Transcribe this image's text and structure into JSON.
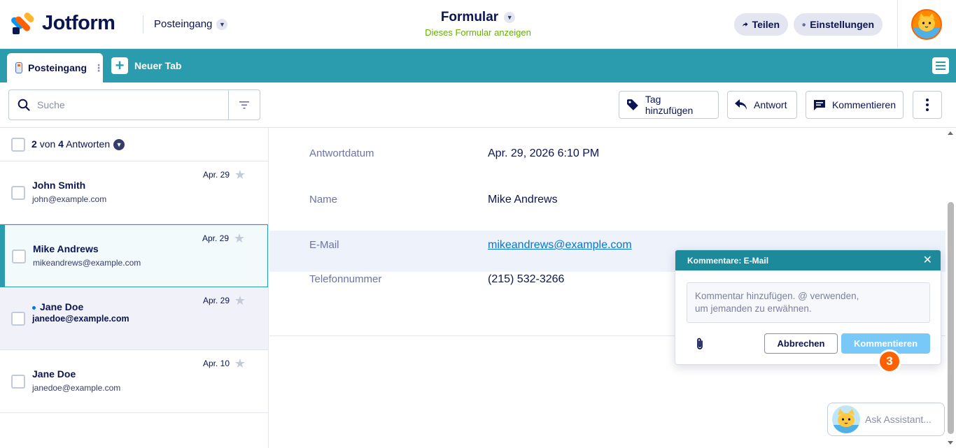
{
  "header": {
    "logo_text": "Jotform",
    "inbox_label": "Posteingang",
    "form_title": "Formular",
    "form_subtitle": "Dieses Formular anzeigen",
    "share_label": "Teilen",
    "settings_label": "Einstellungen"
  },
  "tabs": {
    "active_label": "Posteingang",
    "new_tab_label": "Neuer Tab"
  },
  "toolbar": {
    "search_placeholder": "Suche",
    "tag_label": "Tag hinzufügen",
    "reply_label": "Antwort",
    "comment_label": "Kommentieren"
  },
  "list": {
    "selected_count": "2",
    "of_label": "von",
    "total_count": "4",
    "answers_label": "Antworten",
    "rows": [
      {
        "name": "John Smith",
        "email": "john@example.com",
        "date": "Apr. 29",
        "state": "normal"
      },
      {
        "name": "Mike Andrews",
        "email": "mikeandrews@example.com",
        "date": "Apr. 29",
        "state": "selected"
      },
      {
        "name": "Jane Doe",
        "email": "janedoe@example.com",
        "date": "Apr. 29",
        "state": "unread"
      },
      {
        "name": "Jane Doe",
        "email": "janedoe@example.com",
        "date": "Apr. 10",
        "state": "normal"
      }
    ]
  },
  "detail": {
    "fields": [
      {
        "label": "Antwortdatum",
        "value": "Apr. 29, 2026 6:10 PM"
      },
      {
        "label": "Name",
        "value": "Mike Andrews"
      },
      {
        "label": "E-Mail",
        "value": "mikeandrews@example.com"
      },
      {
        "label": "Telefonnummer",
        "value": "(215) 532-3266"
      }
    ]
  },
  "comment_popup": {
    "title": "Kommentare: E-Mail",
    "placeholder_line1": "Kommentar hinzufügen. @ verwenden,",
    "placeholder_line2": "um jemanden zu erwähnen.",
    "cancel_label": "Abbrechen",
    "submit_label": "Kommentieren"
  },
  "step_badge": "3",
  "assistant": {
    "label": "Ask Assistant..."
  },
  "colors": {
    "accent_teal": "#2b9cad",
    "brand_navy": "#0a1551",
    "link_blue": "#0075e3",
    "badge_orange": "#ff6100",
    "subtitle_green": "#64b200"
  },
  "icons": [
    "search-icon",
    "filter-icon",
    "tag-icon",
    "reply-icon",
    "comment-icon",
    "more-icon",
    "share-icon",
    "gear-icon",
    "star-icon",
    "paperclip-icon",
    "close-icon",
    "menu-icon",
    "plus-icon"
  ]
}
